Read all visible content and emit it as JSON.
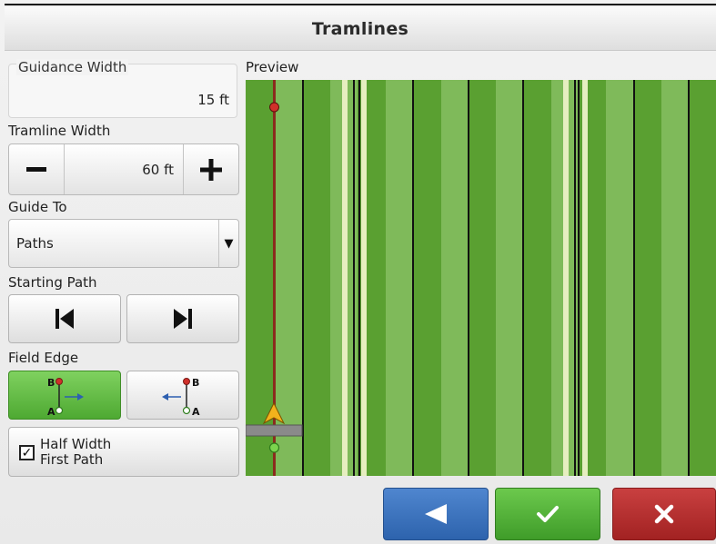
{
  "window": {
    "title": "Tramlines"
  },
  "guidance_width": {
    "label": "Guidance Width",
    "value": "15 ft"
  },
  "tramline_width": {
    "label": "Tramline Width",
    "value": "60 ft",
    "minus_icon": "minus-icon",
    "plus_icon": "plus-icon"
  },
  "guide_to": {
    "label": "Guide To",
    "selected": "Paths"
  },
  "starting_path": {
    "label": "Starting Path",
    "prev_icon": "skip-first-icon",
    "next_icon": "skip-last-icon"
  },
  "field_edge": {
    "label": "Field Edge",
    "left": {
      "top_label": "B",
      "bottom_label": "A",
      "state": "selected"
    },
    "right": {
      "top_label": "B",
      "bottom_label": "A",
      "state": "unselected"
    }
  },
  "half_width": {
    "label_line1": "Half Width",
    "label_line2": "First Path",
    "checked": true
  },
  "preview": {
    "label": "Preview"
  },
  "buttons": {
    "back_icon": "back-triangle-icon",
    "ok_icon": "checkmark-icon",
    "cancel_icon": "x-icon"
  },
  "colors": {
    "field_dark": "#5aa031",
    "field_light": "#7fba5a",
    "tramline": "#e6eec0",
    "path_line": "#8b2b1e",
    "accent_green": "#5cb83c",
    "back_blue": "#3b73bf",
    "cancel_red": "#b52b2b"
  }
}
